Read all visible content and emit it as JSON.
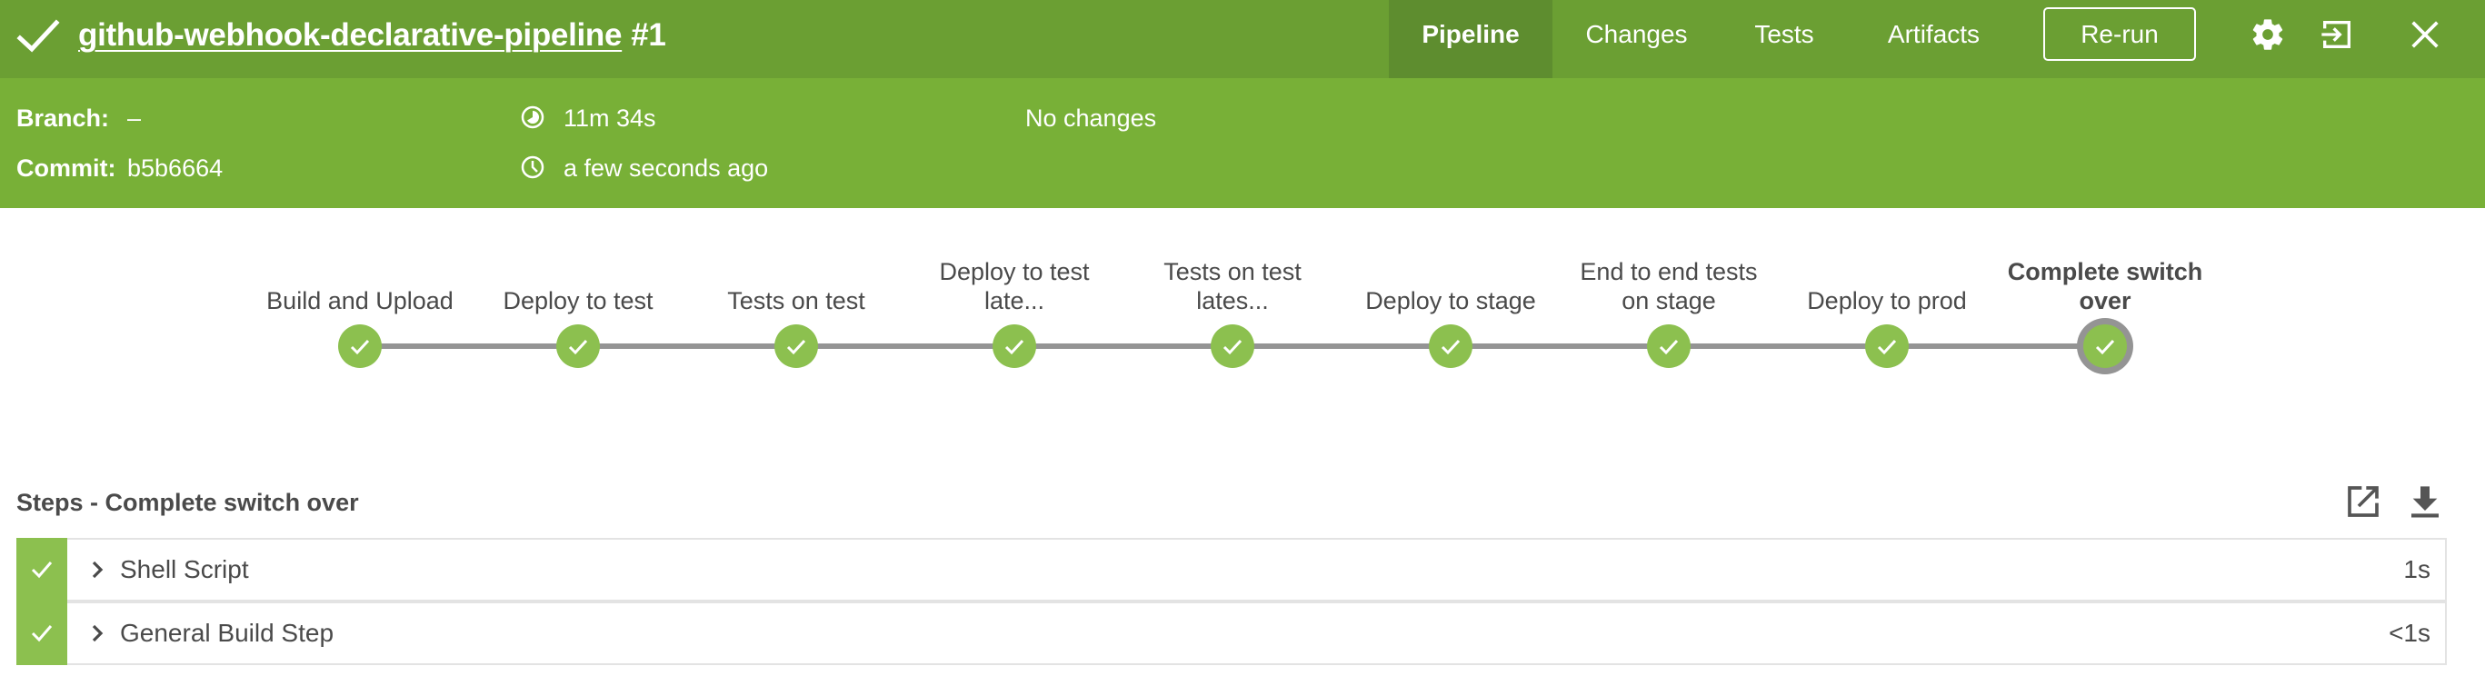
{
  "header": {
    "status": "success",
    "status_icon": "check-icon",
    "pipeline_name": "github-webhook-declarative-pipeline",
    "run_number": "#1",
    "tabs": [
      {
        "label": "Pipeline",
        "active": true
      },
      {
        "label": "Changes",
        "active": false
      },
      {
        "label": "Tests",
        "active": false
      },
      {
        "label": "Artifacts",
        "active": false
      }
    ],
    "rerun_label": "Re-run",
    "icons": [
      "gear-icon",
      "exit-icon",
      "close-icon"
    ]
  },
  "info": {
    "branch_label": "Branch:",
    "branch_value": "–",
    "commit_label": "Commit:",
    "commit_value": "b5b6664",
    "duration": "11m 34s",
    "duration_icon": "duration-clock-icon",
    "started": "a few seconds ago",
    "started_icon": "clock-icon",
    "changes": "No changes"
  },
  "pipeline": {
    "stages": [
      {
        "label": "Build and Upload",
        "status": "success",
        "selected": false
      },
      {
        "label": "Deploy to test",
        "status": "success",
        "selected": false
      },
      {
        "label": "Tests on test",
        "status": "success",
        "selected": false
      },
      {
        "label": "Deploy to test late...",
        "status": "success",
        "selected": false
      },
      {
        "label": "Tests on test lates...",
        "status": "success",
        "selected": false
      },
      {
        "label": "Deploy to stage",
        "status": "success",
        "selected": false
      },
      {
        "label": "End to end tests on stage",
        "status": "success",
        "selected": false
      },
      {
        "label": "Deploy to prod",
        "status": "success",
        "selected": false
      },
      {
        "label": "Complete switch over",
        "status": "success",
        "selected": true
      }
    ]
  },
  "steps": {
    "title": "Steps - Complete switch over",
    "icons": [
      "open-in-new-icon",
      "download-icon"
    ],
    "items": [
      {
        "name": "Shell Script",
        "duration": "1s",
        "status": "success"
      },
      {
        "name": "General Build Step",
        "duration": "<1s",
        "status": "success"
      }
    ]
  },
  "colors": {
    "topbar": "#6b9f33",
    "infobar": "#78b037",
    "active_tab": "#5e8d2f",
    "success": "#8cc04f",
    "connector": "#949494",
    "text": "#4a4a4a"
  }
}
